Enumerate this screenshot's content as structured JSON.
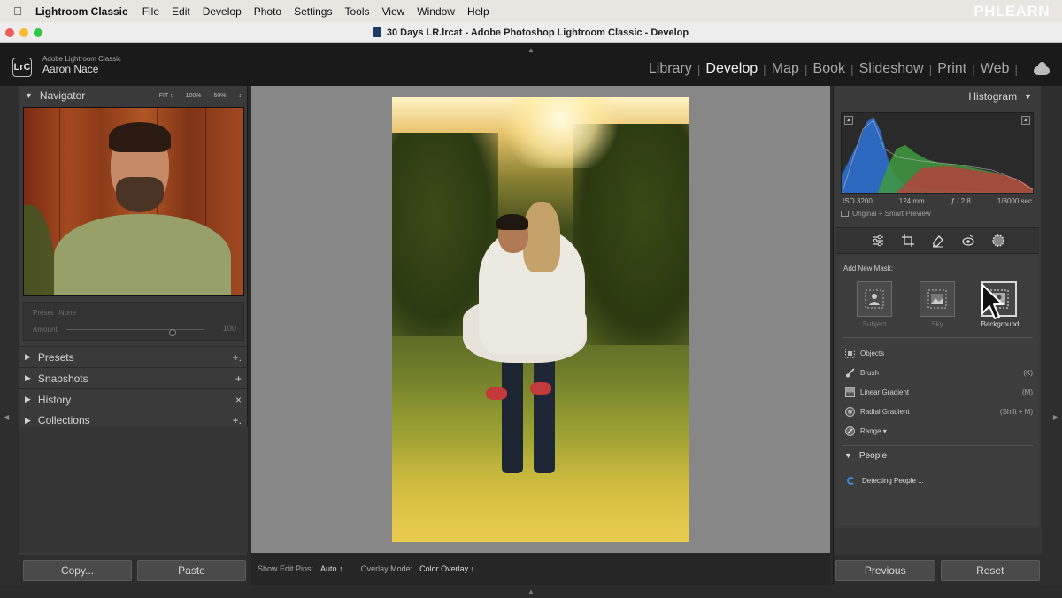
{
  "menubar": {
    "app_name": "Lightroom Classic",
    "items": [
      "File",
      "Edit",
      "Develop",
      "Photo",
      "Settings",
      "Tools",
      "View",
      "Window",
      "Help"
    ],
    "watermark": "PHLEARN"
  },
  "window": {
    "title": "30 Days LR.lrcat - Adobe Photoshop Lightroom Classic - Develop"
  },
  "identity": {
    "logo": "LrC",
    "product": "Adobe Lightroom Classic",
    "user": "Aaron Nace"
  },
  "modules": {
    "items": [
      "Library",
      "Develop",
      "Map",
      "Book",
      "Slideshow",
      "Print",
      "Web"
    ],
    "active": "Develop"
  },
  "navigator": {
    "title": "Navigator",
    "zoom_options": [
      "FIT ↕",
      "100%",
      "50%",
      "↕"
    ]
  },
  "preset": {
    "label": "Preset",
    "value": "None",
    "amount_label": "Amount",
    "amount_value": "100",
    "amount_level": 0.77
  },
  "left_sections": [
    {
      "label": "Presets",
      "action": "+."
    },
    {
      "label": "Snapshots",
      "action": "+"
    },
    {
      "label": "History",
      "action": "×"
    },
    {
      "label": "Collections",
      "action": "+."
    }
  ],
  "left_buttons": {
    "copy": "Copy...",
    "paste": "Paste"
  },
  "toolbar": {
    "edit_pins_label": "Show Edit Pins:",
    "edit_pins_value": "Auto",
    "overlay_label": "Overlay Mode:",
    "overlay_value": "Color Overlay"
  },
  "histogram": {
    "title": "Histogram",
    "iso": "ISO 3200",
    "focal": "124 mm",
    "aperture": "ƒ / 2.8",
    "shutter": "1/8000 sec",
    "preview_status": "Original + Smart Preview"
  },
  "masking": {
    "add_label": "Add New Mask:",
    "buttons": [
      {
        "label": "Subject",
        "selected": false
      },
      {
        "label": "Sky",
        "selected": false
      },
      {
        "label": "Background",
        "selected": true
      }
    ],
    "options": [
      {
        "label": "Objects",
        "shortcut": ""
      },
      {
        "label": "Brush",
        "shortcut": "(K)"
      },
      {
        "label": "Linear Gradient",
        "shortcut": "(M)"
      },
      {
        "label": "Radial Gradient",
        "shortcut": "(Shift + M)"
      },
      {
        "label": "Range ▾",
        "shortcut": ""
      }
    ],
    "people_title": "People",
    "detecting": "Detecting People ..."
  },
  "right_buttons": {
    "previous": "Previous",
    "reset": "Reset"
  },
  "colors": {
    "accent_blue": "#3c8cd8",
    "panel_bg": "#3a3a3a",
    "canvas_bg": "#878787"
  }
}
